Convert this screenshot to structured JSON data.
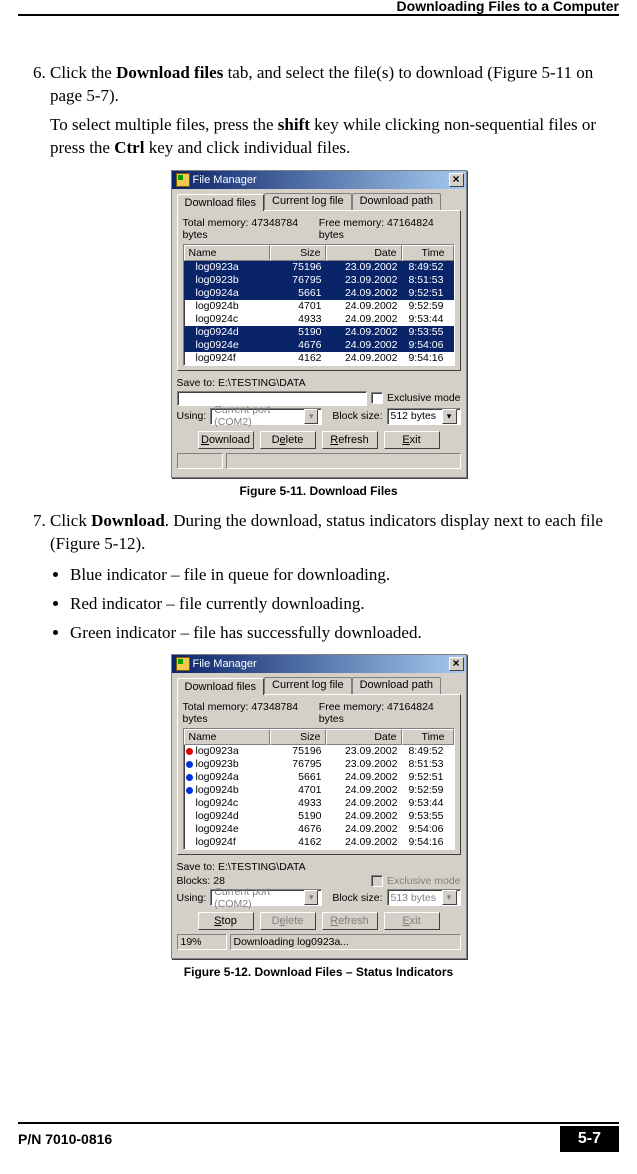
{
  "header": {
    "section": "Downloading Files to a Computer"
  },
  "step6": {
    "p1a": "Click the ",
    "p1b": "Download files",
    "p1c": " tab, and select the file(s) to download (Figure 5-11 on page 5-7).",
    "p2a": "To select multiple files, press the ",
    "p2b": "shift",
    "p2c": " key while clicking non-sequential files or press the ",
    "p2d": "Ctrl",
    "p2e": " key and click individual files."
  },
  "step7": {
    "p1a": "Click ",
    "p1b": "Download",
    "p1c": ". During the download, status indicators display next to each file (Figure 5-12).",
    "bullets": [
      "Blue indicator – file in queue for downloading.",
      "Red indicator – file currently downloading.",
      "Green indicator – file has successfully downloaded."
    ]
  },
  "fig1": {
    "caption": "Figure 5-11. Download Files",
    "title": "File Manager",
    "tabs": [
      "Download files",
      "Current log file",
      "Download path"
    ],
    "mem_total_label": "Total memory: 47348784 bytes",
    "mem_free_label": "Free memory: 47164824 bytes",
    "cols": {
      "name": "Name",
      "size": "Size",
      "date": "Date",
      "time": "Time"
    },
    "rows": [
      {
        "name": "log0923a",
        "size": "75196",
        "date": "23.09.2002",
        "time": "8:49:52",
        "sel": true
      },
      {
        "name": "log0923b",
        "size": "76795",
        "date": "23.09.2002",
        "time": "8:51:53",
        "sel": true
      },
      {
        "name": "log0924a",
        "size": "5661",
        "date": "24.09.2002",
        "time": "9:52:51",
        "sel": true
      },
      {
        "name": "log0924b",
        "size": "4701",
        "date": "24.09.2002",
        "time": "9:52:59",
        "sel": false
      },
      {
        "name": "log0924c",
        "size": "4933",
        "date": "24.09.2002",
        "time": "9:53:44",
        "sel": false
      },
      {
        "name": "log0924d",
        "size": "5190",
        "date": "24.09.2002",
        "time": "9:53:55",
        "sel": true
      },
      {
        "name": "log0924e",
        "size": "4676",
        "date": "24.09.2002",
        "time": "9:54:06",
        "sel": true
      },
      {
        "name": "log0924f",
        "size": "4162",
        "date": "24.09.2002",
        "time": "9:54:16",
        "sel": false
      }
    ],
    "save_to": "Save to: E:\\TESTING\\DATA",
    "exclusive": "Exclusive mode",
    "using_label": "Using:",
    "using_value": "Current port (COM2)",
    "block_label": "Block size:",
    "block_value": "512 bytes",
    "btns": {
      "download": "Download",
      "delete": "Delete",
      "refresh": "Refresh",
      "exit": "Exit"
    }
  },
  "fig2": {
    "caption": "Figure 5-12. Download Files – Status Indicators",
    "title": "File Manager",
    "tabs": [
      "Download files",
      "Current log file",
      "Download path"
    ],
    "mem_total_label": "Total memory: 47348784 bytes",
    "mem_free_label": "Free memory: 47164824 bytes",
    "cols": {
      "name": "Name",
      "size": "Size",
      "date": "Date",
      "time": "Time"
    },
    "rows": [
      {
        "name": "log0923a",
        "size": "75196",
        "date": "23.09.2002",
        "time": "8:49:52",
        "dot": "red"
      },
      {
        "name": "log0923b",
        "size": "76795",
        "date": "23.09.2002",
        "time": "8:51:53",
        "dot": "blue"
      },
      {
        "name": "log0924a",
        "size": "5661",
        "date": "24.09.2002",
        "time": "9:52:51",
        "dot": "blue"
      },
      {
        "name": "log0924b",
        "size": "4701",
        "date": "24.09.2002",
        "time": "9:52:59",
        "dot": "blue"
      },
      {
        "name": "log0924c",
        "size": "4933",
        "date": "24.09.2002",
        "time": "9:53:44",
        "dot": ""
      },
      {
        "name": "log0924d",
        "size": "5190",
        "date": "24.09.2002",
        "time": "9:53:55",
        "dot": ""
      },
      {
        "name": "log0924e",
        "size": "4676",
        "date": "24.09.2002",
        "time": "9:54:06",
        "dot": ""
      },
      {
        "name": "log0924f",
        "size": "4162",
        "date": "24.09.2002",
        "time": "9:54:16",
        "dot": ""
      }
    ],
    "save_to": "Save to: E:\\TESTING\\DATA",
    "blocks_label": "Blocks: 28",
    "exclusive": "Exclusive mode",
    "using_label": "Using:",
    "using_value": "Current port (COM2)",
    "block_label": "Block size:",
    "block_value": "513 bytes",
    "btns": {
      "stop": "Stop",
      "delete": "Delete",
      "refresh": "Refresh",
      "exit": "Exit"
    },
    "progress_pct": "19%",
    "progress_msg": "Downloading log0923a..."
  },
  "footer": {
    "pn": "P/N 7010-0816",
    "page": "5-7"
  }
}
